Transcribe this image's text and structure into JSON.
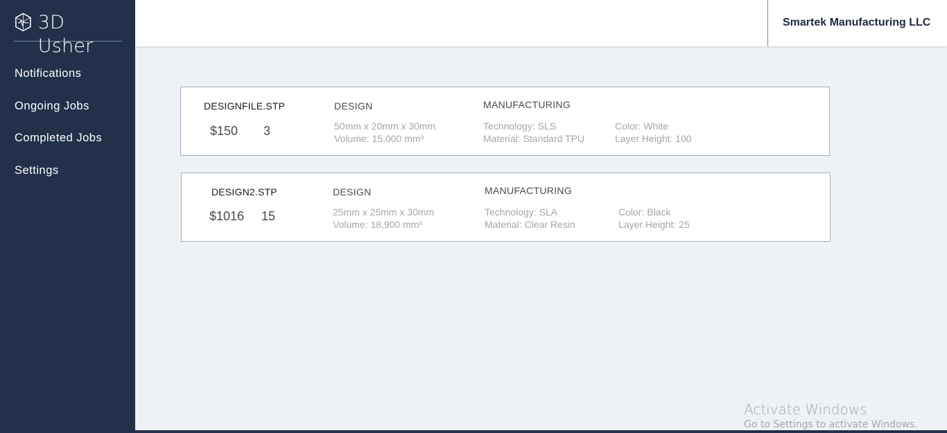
{
  "app": {
    "brand_name": "3D Usher",
    "logo_icon": "cube-logo-icon"
  },
  "sidebar": {
    "items": [
      {
        "label": "Notifications"
      },
      {
        "label": "Ongoing Jobs"
      },
      {
        "label": "Completed Jobs"
      },
      {
        "label": "Settings"
      }
    ]
  },
  "header": {
    "company_name": "Smartek Manufacturing LLC"
  },
  "jobs": [
    {
      "file_name": "DESIGNFILE.STP",
      "price": "$150",
      "quantity": "3",
      "design_heading": "DESIGN",
      "dimensions": "50mm x 20mm x 30mm",
      "volume": "Volume: 15,000 mm³",
      "manufacturing_heading": "MANUFACTURING",
      "technology": "Technology: SLS",
      "material": "Material: Standard TPU",
      "color": "Color: White",
      "layer_height": "Layer Height: 100"
    },
    {
      "file_name": "DESIGN2.STP",
      "price": "$1016",
      "quantity": "15",
      "design_heading": "DESIGN",
      "dimensions": "25mm x 25mm x 30mm",
      "volume": "Volume: 18,900 mm³",
      "manufacturing_heading": "MANUFACTURING",
      "technology": "Technology: SLA",
      "material": "Material: Clear Resin",
      "color": "Color: Black",
      "layer_height": "Layer Height: 25"
    }
  ],
  "watermark": {
    "title": "Activate Windows",
    "subtitle": "Go to Settings to activate Windows."
  },
  "colors": {
    "sidebar_bg": "#22304a",
    "content_bg": "#eef1f5",
    "card_border": "#a8afb8"
  }
}
